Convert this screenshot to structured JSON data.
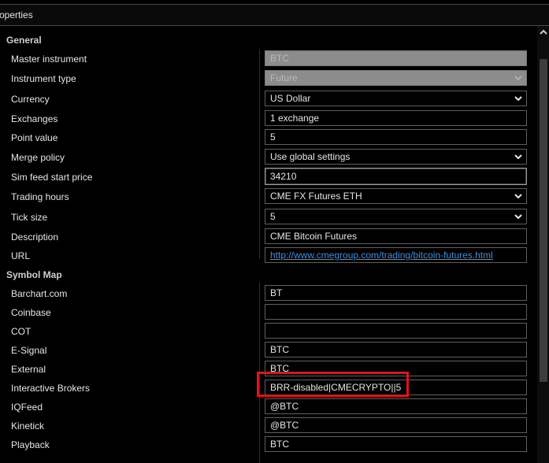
{
  "window": {
    "title": "operties"
  },
  "categories": {
    "general": "General",
    "symbol_map": "Symbol Map"
  },
  "general": {
    "master_instrument": {
      "label": "Master instrument",
      "value": "BTC"
    },
    "instrument_type": {
      "label": "Instrument type",
      "value": "Future"
    },
    "currency": {
      "label": "Currency",
      "value": "US Dollar"
    },
    "exchanges": {
      "label": "Exchanges",
      "value": "1 exchange"
    },
    "point_value": {
      "label": "Point value",
      "value": "5"
    },
    "merge_policy": {
      "label": "Merge policy",
      "value": "Use global settings"
    },
    "sim_feed_start_price": {
      "label": "Sim feed start price",
      "value": "34210"
    },
    "trading_hours": {
      "label": "Trading hours",
      "value": "CME FX Futures ETH"
    },
    "tick_size": {
      "label": "Tick size",
      "value": "5"
    },
    "description": {
      "label": "Description",
      "value": "CME Bitcoin Futures"
    },
    "url": {
      "label": "URL",
      "value": "http://www.cmegroup.com/trading/bitcoin-futures.html"
    }
  },
  "symbol_map": {
    "barchart": {
      "label": "Barchart.com",
      "value": "BT"
    },
    "coinbase": {
      "label": "Coinbase",
      "value": ""
    },
    "cot": {
      "label": "COT",
      "value": ""
    },
    "esignal": {
      "label": "E-Signal",
      "value": "BTC"
    },
    "external": {
      "label": "External",
      "value": "BTC"
    },
    "interactive_brokers": {
      "label": "Interactive Brokers",
      "value": "BRR-disabled|CMECRYPTO||5"
    },
    "iqfeed": {
      "label": "IQFeed",
      "value": "@BTC"
    },
    "kinetick": {
      "label": "Kinetick",
      "value": "@BTC"
    },
    "playback": {
      "label": "Playback",
      "value": "BTC"
    }
  },
  "colors": {
    "highlight": "#e0141a",
    "link": "#3a8fe6",
    "background": "#000000"
  },
  "icons": {
    "dropdown": "chevron-down-icon",
    "scroll_up": "scroll-up-arrow-icon"
  }
}
